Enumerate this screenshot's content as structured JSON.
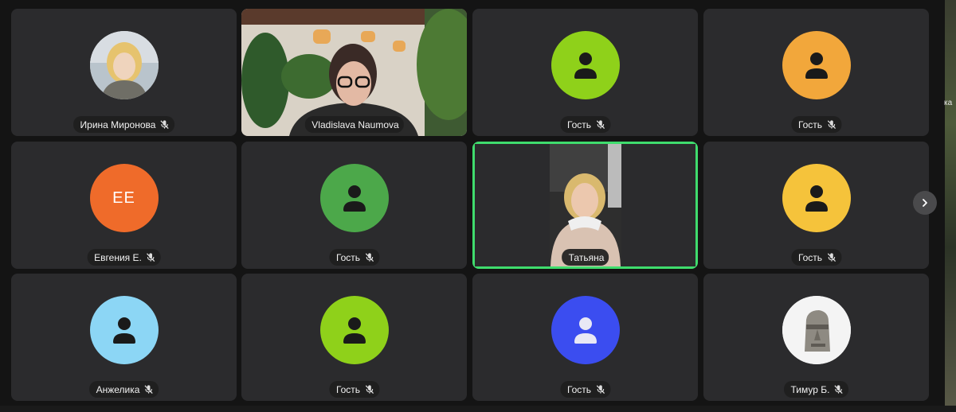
{
  "participants": [
    {
      "name": "Ирина Миронова",
      "muted": true,
      "type": "photo"
    },
    {
      "name": "Vladislava Naumova",
      "muted": false,
      "type": "video"
    },
    {
      "name": "Гость",
      "muted": true,
      "type": "placeholder",
      "color": "#8fd11a"
    },
    {
      "name": "Гость",
      "muted": true,
      "type": "placeholder",
      "color": "#f2a73b"
    },
    {
      "name": "Евгения Е.",
      "muted": true,
      "type": "initials",
      "initials": "ЕЕ",
      "color": "#ef6b2a"
    },
    {
      "name": "Гость",
      "muted": true,
      "type": "placeholder",
      "color": "#4ca84a"
    },
    {
      "name": "Татьяна",
      "muted": false,
      "type": "video",
      "speaking": true
    },
    {
      "name": "Гость",
      "muted": true,
      "type": "placeholder",
      "color": "#f5c33b"
    },
    {
      "name": "Анжелика",
      "muted": true,
      "type": "placeholder",
      "color": "#8cd6f5"
    },
    {
      "name": "Гость",
      "muted": true,
      "type": "placeholder",
      "color": "#8fd11a"
    },
    {
      "name": "Гость",
      "muted": true,
      "type": "placeholder",
      "color": "#3b4df0"
    },
    {
      "name": "Тимур Б.",
      "muted": true,
      "type": "photo"
    }
  ],
  "controls": {
    "next_page_icon": "chevron-right-icon"
  },
  "side_text": "ка"
}
